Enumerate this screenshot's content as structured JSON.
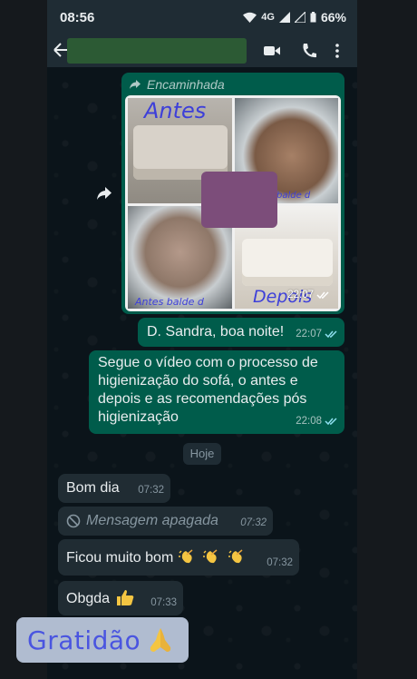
{
  "status_bar": {
    "time": "08:56",
    "network": "4G",
    "battery": "66%"
  },
  "header": {
    "contact_name": "",
    "icons": [
      "back-arrow-icon",
      "video-call-icon",
      "phone-call-icon",
      "more-options-icon"
    ]
  },
  "messages": [
    {
      "type": "image",
      "direction": "outgoing",
      "forwarded_label": "Encaminhada",
      "photo_labels": [
        "Antes",
        "balde d",
        "Antes balde d",
        "Depois"
      ],
      "time": "22:07",
      "status": "read"
    },
    {
      "type": "text",
      "direction": "outgoing",
      "text": "D. Sandra, boa noite!",
      "time": "22:07",
      "status": "read"
    },
    {
      "type": "text",
      "direction": "outgoing",
      "text": "Segue o vídeo com o processo de higienização do sofá, o antes e depois e as recomendações pós higienização",
      "time": "22:08",
      "status": "read"
    },
    {
      "type": "day-separator",
      "text": "Hoje"
    },
    {
      "type": "text",
      "direction": "incoming",
      "text": "Bom dia",
      "time": "07:32"
    },
    {
      "type": "deleted",
      "direction": "incoming",
      "text": "Mensagem apagada",
      "time": "07:32"
    },
    {
      "type": "text",
      "direction": "incoming",
      "text": "Ficou muito bom",
      "emoji": "clapping-hands x3",
      "time": "07:32"
    },
    {
      "type": "text",
      "direction": "incoming",
      "text": "Obgda",
      "emoji": "thumbs-up",
      "time": "07:33"
    }
  ],
  "sticker": {
    "text": "Gratidão",
    "emoji": "folded-hands"
  },
  "colors": {
    "outgoing_bubble": "#005c4b",
    "incoming_bubble": "#202c33",
    "header": "#1f2c34",
    "background": "#0b141a",
    "read_ticks": "#8ee0f0"
  }
}
